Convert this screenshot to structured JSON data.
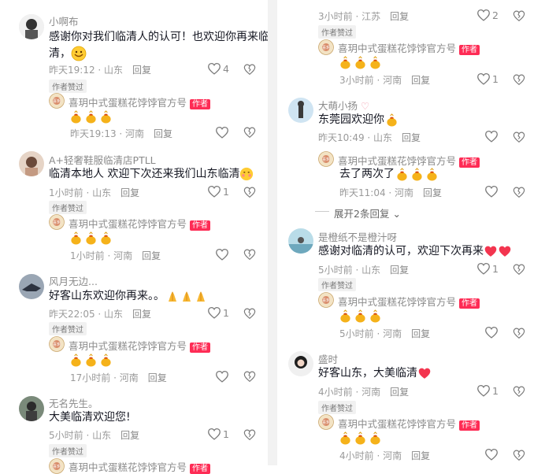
{
  "author_name": "喜玥中式蛋糕花饽饽官方号",
  "author_badge": "作者",
  "liked_badge": "作者赞过",
  "reply_label": "回复",
  "expand_label": "展开2条回复",
  "left": {
    "c1": {
      "name": "小啊布",
      "text1": "感谢你对我们临清人的认可！也欢迎你再来临",
      "text2": "清，",
      "time": "昨天19:12 · 山东",
      "likes": "4",
      "reply_time": "昨天19:13 · 河南"
    },
    "c2": {
      "name": "A+轻奢鞋服临清店PTLL",
      "text": "临清本地人  欢迎下次还来我们山东临清",
      "time": "1小时前 · 山东",
      "likes": "1",
      "reply_time": "1小时前 · 河南"
    },
    "c3": {
      "name": "风月无边...",
      "text": "好客山东欢迎你再来。。",
      "time": "昨天22:05 · 山东",
      "likes": "1",
      "reply_time": "17小时前 · 河南"
    },
    "c4": {
      "name": "无名先生。",
      "text": "大美临清欢迎您!",
      "time": "5小时前 · 山东",
      "likes": "1",
      "cut_name": "喜玥中式蛋糕花饽饽官方号"
    }
  },
  "right": {
    "top": {
      "time": "3小时前 · 江苏",
      "likes": "2",
      "reply_time": "3小时前 · 河南",
      "reply_likes": "1"
    },
    "c1": {
      "name": "大萌小扬",
      "text": "东莞园欢迎你",
      "time": "昨天10:49 · 山东",
      "reply_text": "去了两次了",
      "reply_time": "昨天11:04 · 河南"
    },
    "c2": {
      "name": "是橙纸不是橙汁呀",
      "text": "感谢对临清的认可，欢迎下次再来",
      "time": "5小时前 · 山东",
      "likes": "1",
      "reply_time": "5小时前 · 河南"
    },
    "c3": {
      "name": "盛时",
      "text": "好客山东，大美临清",
      "time": "4小时前 · 河南",
      "likes": "1",
      "reply_time": "4小时前 · 河南"
    }
  },
  "colors": {
    "author_tag": "#fe2c55",
    "text": "#161823",
    "meta": "#9a9a9a"
  }
}
